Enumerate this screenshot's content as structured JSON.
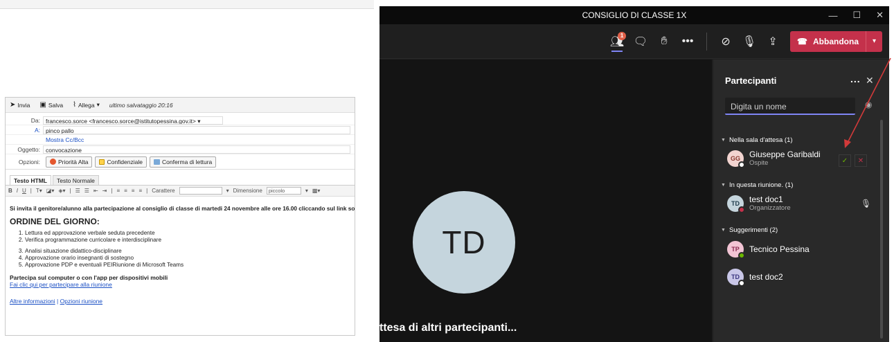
{
  "email": {
    "toolbar": {
      "send_label": "Invia",
      "save_label": "Salva",
      "attach_label": "Allega",
      "last_saved": "ultimo salvataggio 20:16"
    },
    "from_label": "Da:",
    "from_value": "francesco.sorce <francesco.sorce@istitutopessina.gov.it>",
    "to_label": "A:",
    "to_value": "pinco pallo",
    "cc_link": "Mostra Cc/Bcc",
    "subject_label": "Oggetto:",
    "subject_value": "convocazione",
    "options_label": "Opzioni:",
    "options": {
      "high_priority": "Priorità Alta",
      "confidential": "Confidenziale",
      "read_receipt": "Conferma di lettura"
    },
    "tabs": {
      "html": "Testo HTML",
      "plain": "Testo Normale"
    },
    "format": {
      "bold": "B",
      "italic": "I",
      "underline": "U",
      "font_label": "Carattere",
      "size_label": "Dimensione",
      "size_value": "piccolo"
    },
    "body": {
      "intro": "Si invita il genitore/alunno alla partecipazione al consiglio di classe di  martedi 24 novembre alle ore 16.00 cliccando sul link sotto riportato",
      "heading": "ORDINE DEL GIORNO:",
      "items_a": [
        "Lettura ed approvazione verbale seduta precedente",
        "Verifica programmazione curricolare e interdisciplinare"
      ],
      "items_b": [
        "Analisi situazione didattico-disciplinare",
        "Approvazione orario insegnanti di sostegno",
        "Approvazione PDP e eventuali PEIRiunione di Microsoft Teams"
      ],
      "join_text": "Partecipa sul computer o con l'app per dispositivi mobili",
      "join_link": "Fai clic qui per partecipare alla riunione",
      "more_info": "Altre informazioni",
      "separator": " | ",
      "meeting_options": "Opzioni riunione"
    }
  },
  "teams": {
    "title": "CONSIGLIO DI CLASSE 1X",
    "participants_badge": "1",
    "leave_label": "Abbandona",
    "stage": {
      "avatar_initials": "TD",
      "waiting_text": "ttesa di altri partecipanti..."
    },
    "panel": {
      "title": "Partecipanti",
      "more": "...",
      "search_placeholder": "Digita un nome",
      "lobby_header": "Nella sala d'attesa (1)",
      "in_meeting_header": "In questa riunione. (1)",
      "suggestions_header": "Suggerimenti (2)",
      "lobby": [
        {
          "initials": "GG",
          "name": "Giuseppe Garibaldi",
          "role": "Ospite"
        }
      ],
      "in_meeting": [
        {
          "initials": "TD",
          "name": "test doc1",
          "role": "Organizzatore"
        }
      ],
      "suggestions": [
        {
          "initials": "TP",
          "name": "Tecnico Pessina"
        },
        {
          "initials": "TD",
          "name": "test doc2"
        }
      ]
    },
    "colors": {
      "accent": "#7f85f5",
      "leave_red": "#c4314b",
      "badge": "#e0614a",
      "accept_green": "#6bb700",
      "reject_red": "#c4314b"
    }
  }
}
